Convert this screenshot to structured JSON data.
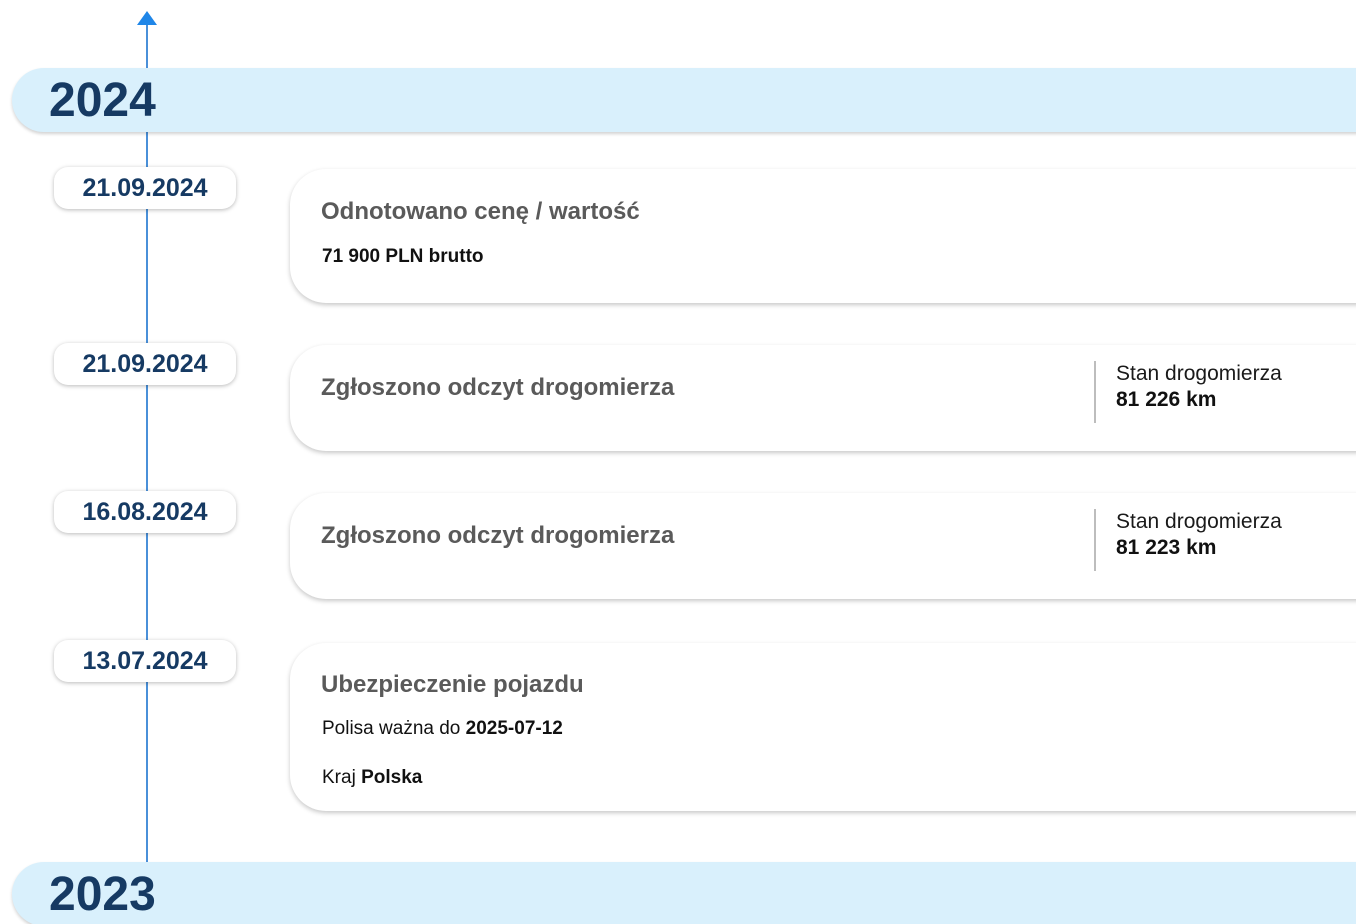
{
  "timeline": {
    "arrow_icon": "arrow-up-icon",
    "accent_color": "#1f86e8",
    "years": [
      {
        "label": "2024"
      },
      {
        "label": "2023"
      }
    ]
  },
  "events": [
    {
      "date": "21.09.2024",
      "title": "Odnotowano cenę / wartość",
      "price": "71 900 PLN brutto"
    },
    {
      "date": "21.09.2024",
      "title": "Zgłoszono odczyt drogomierza",
      "odometer_label": "Stan drogomierza",
      "odometer_value": "81 226 km"
    },
    {
      "date": "16.08.2024",
      "title": "Zgłoszono odczyt drogomierza",
      "odometer_label": "Stan drogomierza",
      "odometer_value": "81 223 km"
    },
    {
      "date": "13.07.2024",
      "title": "Ubezpieczenie pojazdu",
      "policy_label": "Polisa ważna do",
      "policy_value": "2025-07-12",
      "country_label": "Kraj",
      "country_value": "Polska"
    }
  ],
  "colors": {
    "year_band_bg": "#d9f0fc",
    "year_text": "#163a63",
    "date_text": "#163a63",
    "title_text": "#5a5a5a"
  }
}
